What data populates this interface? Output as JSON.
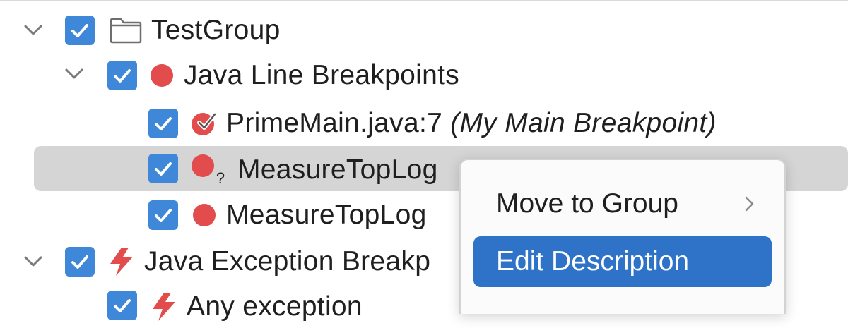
{
  "tree": {
    "rows": [
      {
        "label": "TestGroup",
        "note": ""
      },
      {
        "label": "Java Line Breakpoints",
        "note": ""
      },
      {
        "label": "PrimeMain.java:7",
        "note": "(My Main Breakpoint)"
      },
      {
        "label": "MeasureTopLog",
        "note": ""
      },
      {
        "label": "MeasureTopLog",
        "note": ""
      },
      {
        "label": "Java Exception Breakp",
        "note": ""
      },
      {
        "label": "Any exception",
        "note": ""
      }
    ]
  },
  "context_menu": {
    "items": [
      {
        "label": "Move to Group"
      },
      {
        "label": "Edit Description"
      }
    ]
  },
  "colors": {
    "checkbox": "#3f87d8",
    "breakpoint": "#e24c4c",
    "exception": "#e24c4c",
    "selection": "#d5d5d5",
    "menu_active": "#2f73c9"
  },
  "icons": [
    "chevron-down-icon",
    "checkbox-checked-icon",
    "folder-icon",
    "breakpoint-dot-icon",
    "breakpoint-logged-icon",
    "breakpoint-unverified-icon",
    "lightning-icon",
    "chevron-right-icon"
  ]
}
